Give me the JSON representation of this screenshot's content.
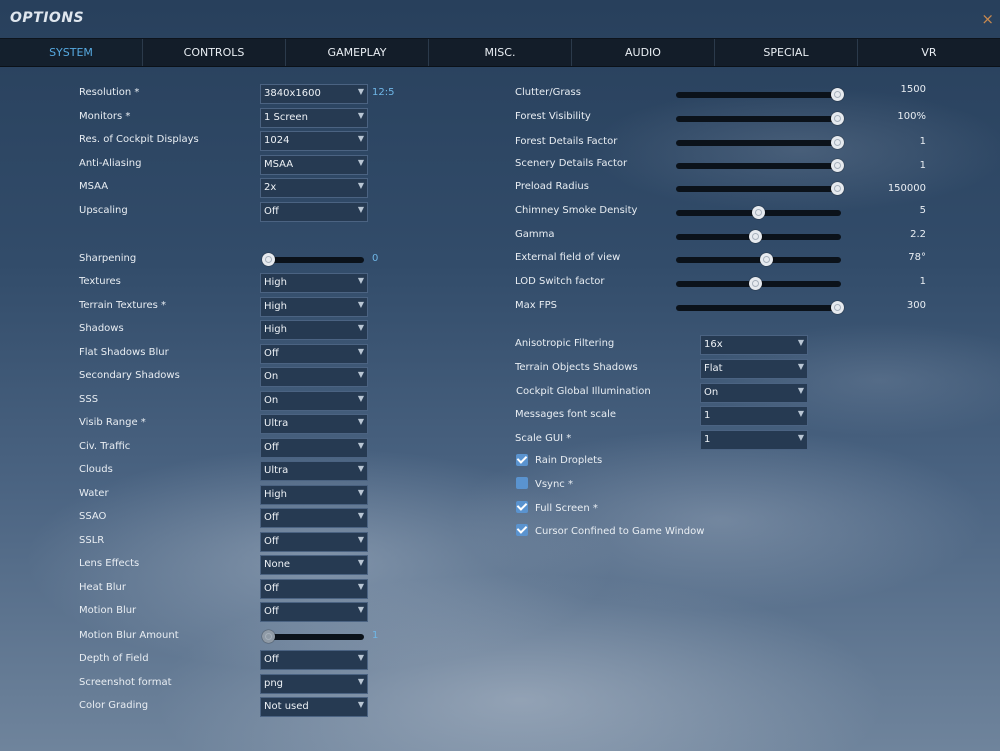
{
  "title": "OPTIONS",
  "close_glyph": "×",
  "tabs": [
    {
      "label": "SYSTEM",
      "active": true
    },
    {
      "label": "CONTROLS",
      "active": false
    },
    {
      "label": "GAMEPLAY",
      "active": false
    },
    {
      "label": "MISC.",
      "active": false
    },
    {
      "label": "AUDIO",
      "active": false
    },
    {
      "label": "SPECIAL",
      "active": false
    },
    {
      "label": "VR",
      "active": false
    }
  ],
  "left": {
    "resolution": {
      "label": "Resolution *",
      "value": "3840x1600",
      "aspect": "12:5"
    },
    "monitors": {
      "label": "Monitors *",
      "value": "1 Screen"
    },
    "cockpit_displays": {
      "label": "Res. of Cockpit Displays",
      "value": "1024"
    },
    "anti_aliasing": {
      "label": "Anti-Aliasing",
      "value": "MSAA"
    },
    "msaa": {
      "label": "MSAA",
      "value": "2x"
    },
    "upscaling": {
      "label": "Upscaling",
      "value": "Off"
    },
    "sharpening": {
      "label": "Sharpening",
      "value": "0",
      "position": 0
    },
    "textures": {
      "label": "Textures",
      "value": "High"
    },
    "terrain_textures": {
      "label": "Terrain Textures *",
      "value": "High"
    },
    "shadows": {
      "label": "Shadows",
      "value": "High"
    },
    "flat_shadows_blur": {
      "label": "Flat Shadows Blur",
      "value": "Off"
    },
    "secondary_shadows": {
      "label": "Secondary Shadows",
      "value": "On"
    },
    "sss": {
      "label": "SSS",
      "value": "On"
    },
    "visib_range": {
      "label": "Visib Range *",
      "value": "Ultra"
    },
    "civ_traffic": {
      "label": "Civ. Traffic",
      "value": "Off"
    },
    "clouds": {
      "label": "Clouds",
      "value": "Ultra"
    },
    "water": {
      "label": "Water",
      "value": "High"
    },
    "ssao": {
      "label": "SSAO",
      "value": "Off"
    },
    "sslr": {
      "label": "SSLR",
      "value": "Off"
    },
    "lens_effects": {
      "label": "Lens Effects",
      "value": "None"
    },
    "heat_blur": {
      "label": "Heat Blur",
      "value": "Off"
    },
    "motion_blur": {
      "label": "Motion Blur",
      "value": "Off"
    },
    "motion_blur_amount": {
      "label": "Motion Blur Amount",
      "value": "1",
      "position": 0
    },
    "depth_of_field": {
      "label": "Depth of Field",
      "value": "Off"
    },
    "screenshot_format": {
      "label": "Screenshot format",
      "value": "png"
    },
    "color_grading": {
      "label": "Color Grading",
      "value": "Not used"
    }
  },
  "right": {
    "clutter_grass": {
      "label": "Clutter/Grass",
      "value": "1500",
      "position": 1.0
    },
    "forest_visibility": {
      "label": "Forest Visibility",
      "value": "100%",
      "position": 1.0
    },
    "forest_details": {
      "label": "Forest Details Factor",
      "value": "1",
      "position": 1.0
    },
    "scenery_details": {
      "label": "Scenery Details Factor",
      "value": "1",
      "position": 1.0
    },
    "preload_radius": {
      "label": "Preload Radius",
      "value": "150000",
      "position": 1.0
    },
    "chimney_smoke": {
      "label": "Chimney Smoke Density",
      "value": "5",
      "position": 0.5
    },
    "gamma": {
      "label": "Gamma",
      "value": "2.2",
      "position": 0.48
    },
    "external_fov": {
      "label": "External field of view",
      "value": "78°",
      "position": 0.55
    },
    "lod_switch": {
      "label": "LOD Switch factor",
      "value": "1",
      "position": 0.48
    },
    "max_fps": {
      "label": "Max FPS",
      "value": "300",
      "position": 1.0
    },
    "anisotropic": {
      "label": "Anisotropic Filtering",
      "value": "16x"
    },
    "terrain_obj_shadows": {
      "label": "Terrain Objects Shadows",
      "value": "Flat"
    },
    "cockpit_gi": {
      "label": "Cockpit Global Illumination",
      "value": "On"
    },
    "messages_font": {
      "label": "Messages font scale",
      "value": "1"
    },
    "scale_gui": {
      "label": "Scale GUI *",
      "value": "1"
    },
    "rain_droplets": {
      "label": "Rain Droplets",
      "checked": true
    },
    "vsync": {
      "label": "Vsync *",
      "checked": false
    },
    "full_screen": {
      "label": "Full Screen *",
      "checked": true
    },
    "cursor_confined": {
      "label": "Cursor Confined to Game Window",
      "checked": true
    }
  },
  "icons": {
    "dropdown_arrow": "chevron-down-icon",
    "close": "close-icon",
    "check": "checkmark-icon"
  },
  "colors": {
    "accent": "#56a9e0",
    "close": "#c9894e",
    "checkbox": "#5a93cf"
  }
}
